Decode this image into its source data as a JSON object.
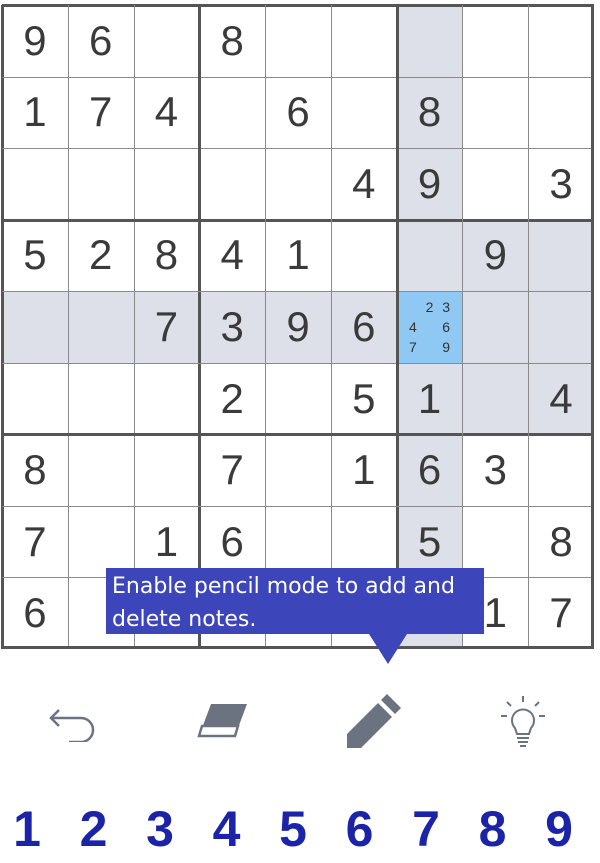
{
  "board": {
    "rows": [
      [
        "9",
        "6",
        "",
        "8",
        "",
        "",
        "",
        "",
        ""
      ],
      [
        "1",
        "7",
        "4",
        "",
        "6",
        "",
        "8",
        "",
        ""
      ],
      [
        "",
        "",
        "",
        "",
        "",
        "4",
        "9",
        "",
        "3"
      ],
      [
        "5",
        "2",
        "8",
        "4",
        "1",
        "",
        "",
        "9",
        ""
      ],
      [
        "",
        "",
        "7",
        "3",
        "9",
        "6",
        "",
        "",
        ""
      ],
      [
        "",
        "",
        "",
        "2",
        "",
        "5",
        "1",
        "",
        "4"
      ],
      [
        "8",
        "",
        "",
        "7",
        "",
        "1",
        "6",
        "3",
        ""
      ],
      [
        "7",
        "",
        "1",
        "6",
        "",
        "",
        "5",
        "",
        "8"
      ],
      [
        "6",
        "",
        "",
        "",
        "",
        "",
        "",
        "1",
        "7"
      ]
    ],
    "selected": {
      "row": 4,
      "col": 6
    },
    "notes": [
      "2",
      "3",
      "4",
      "6",
      "7",
      "9"
    ],
    "highlight_color": "#dde0e8",
    "selected_color": "#8fc8f2"
  },
  "tooltip": {
    "text": "Enable pencil mode to add and delete notes."
  },
  "toolbar": {
    "undo_icon": "undo-icon",
    "eraser_icon": "eraser-icon",
    "pencil_icon": "pencil-icon",
    "hint_icon": "lightbulb-icon"
  },
  "numpad": [
    "1",
    "2",
    "3",
    "4",
    "5",
    "6",
    "7",
    "8",
    "9"
  ],
  "colors": {
    "numpad": "#1b24a6",
    "tooltip": "#3c45b9"
  }
}
